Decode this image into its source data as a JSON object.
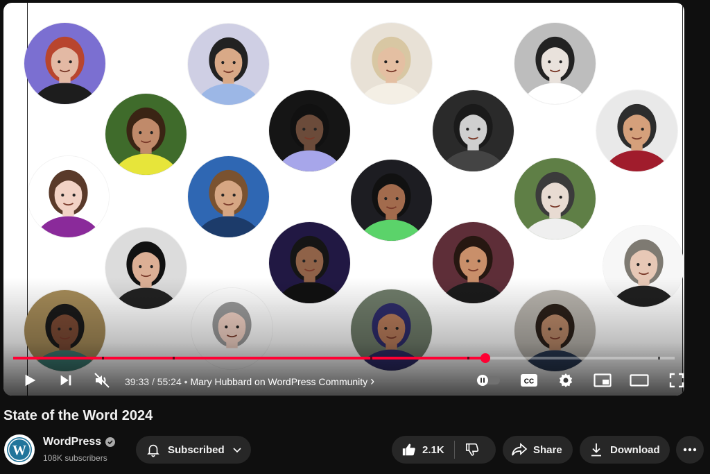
{
  "player": {
    "current_time": "39:33",
    "separator": "/",
    "duration": "55:24",
    "bullet": "•",
    "chapter": "Mary Hubbard on WordPress Community",
    "chapter_chevron": "›",
    "progress_fraction": 0.714,
    "buffer_fraction": 0.72,
    "cc_label": "CC",
    "icons": {
      "play": "play-icon",
      "next": "next-icon",
      "mute": "muted-volume-icon",
      "autoplay": "autoplay-toggle-icon",
      "captions": "captions-icon",
      "settings": "gear-icon",
      "miniplayer": "miniplayer-icon",
      "theater": "theater-mode-icon",
      "fullscreen": "fullscreen-icon"
    }
  },
  "video": {
    "title": "State of the Word 2024"
  },
  "channel": {
    "name": "WordPress",
    "subscribers": "108K subscribers",
    "logo_letter": "W"
  },
  "actions": {
    "subscribe_label": "Subscribed",
    "like_count": "2.1K",
    "share_label": "Share",
    "download_label": "Download"
  },
  "colors": {
    "progress": "#ff0033",
    "page_bg": "#0f0f0f",
    "pill_bg": "#272727",
    "wordpress_blue": "#21759b"
  }
}
